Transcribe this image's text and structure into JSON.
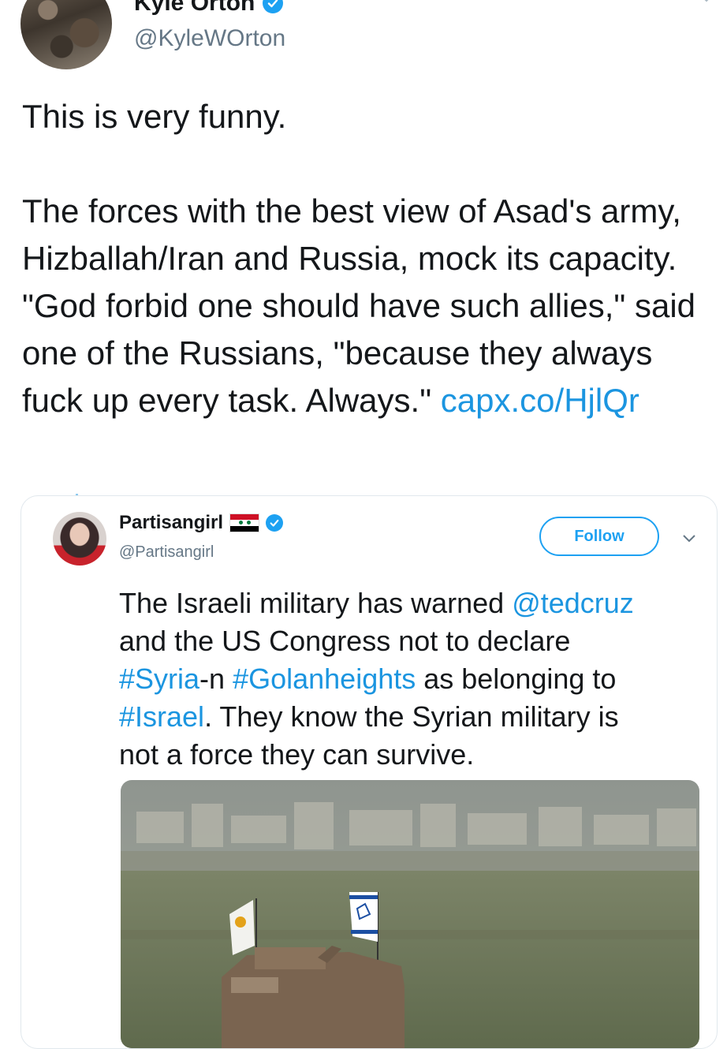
{
  "tweet": {
    "display_name": "Kyle Orton",
    "handle": "@KyleWOrton",
    "text_before_link": "This is very funny.\n\nThe forces with the best view of Asad's army, Hizballah/Iran and Russia, mock its capacity. \"God forbid one should have such allies,\" said one of the Russians, \"because they always fuck up every task. Always.\" ",
    "link_text": "capx.co/HjlQr"
  },
  "quoted_tweet": {
    "display_name": "Partisangirl",
    "handle": "@Partisangirl",
    "follow_label": "Follow",
    "text_parts": {
      "p1": "The Israeli military has warned ",
      "mention": "@tedcruz",
      "p2": "\nand the US Congress not to declare\n",
      "hashtag_syria": "#Syria",
      "p3": "-n ",
      "hashtag_golan": "#Golanheights",
      "p4": " as belonging to\n",
      "hashtag_israel": "#Israel",
      "p5": ". They know the Syrian military is\nnot a force they can survive."
    }
  },
  "colors": {
    "link": "#1b95e0",
    "verified": "#1da1f2",
    "handle": "#657786",
    "text": "#14171a"
  },
  "icons": [
    "verified-badge-icon",
    "chevron-down-icon",
    "syria-flag-icon"
  ]
}
